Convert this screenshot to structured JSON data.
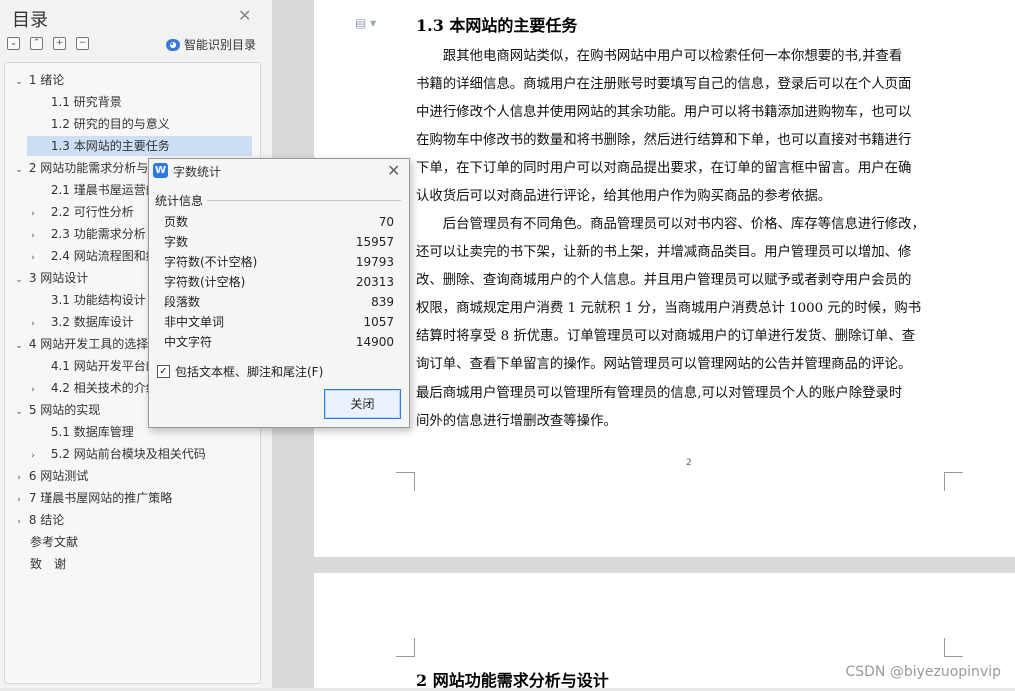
{
  "sidebar": {
    "title": "目录",
    "smart_toc_label": "智能识别目录",
    "toc": [
      {
        "label": "1 绪论",
        "level": 1,
        "arrow": "⌄"
      },
      {
        "label": "1.1 研究背景",
        "level": 2,
        "arrow": ""
      },
      {
        "label": "1.2 研究的目的与意义",
        "level": 2,
        "arrow": ""
      },
      {
        "label": "1.3 本网站的主要任务",
        "level": 2,
        "arrow": "",
        "selected": true
      },
      {
        "label": "2 网站功能需求分析与",
        "level": 1,
        "arrow": "⌄"
      },
      {
        "label": "2.1 瑾晨书屋运营的",
        "level": 2,
        "arrow": ""
      },
      {
        "label": "2.2 可行性分析",
        "level": 2,
        "arrow": "›"
      },
      {
        "label": "2.3 功能需求分析",
        "level": 2,
        "arrow": "›"
      },
      {
        "label": "2.4 网站流程图和结",
        "level": 2,
        "arrow": "›"
      },
      {
        "label": "3 网站设计",
        "level": 1,
        "arrow": "⌄"
      },
      {
        "label": "3.1 功能结构设计",
        "level": 2,
        "arrow": ""
      },
      {
        "label": "3.2 数据库设计",
        "level": 2,
        "arrow": "›"
      },
      {
        "label": "4 网站开发工具的选择",
        "level": 1,
        "arrow": "⌄"
      },
      {
        "label": "4.1 网站开发平台的",
        "level": 2,
        "arrow": ""
      },
      {
        "label": "4.2 相关技术的介绍",
        "level": 2,
        "arrow": "›"
      },
      {
        "label": "5 网站的实现",
        "level": 1,
        "arrow": "⌄"
      },
      {
        "label": "5.1 数据库管理",
        "level": 2,
        "arrow": ""
      },
      {
        "label": "5.2 网站前台模块及相关代码",
        "level": 2,
        "arrow": "›"
      },
      {
        "label": "6 网站测试",
        "level": 1,
        "arrow": "›"
      },
      {
        "label": "7 瑾晨书屋网站的推广策略",
        "level": 1,
        "arrow": "›"
      },
      {
        "label": "8 结论",
        "level": 1,
        "arrow": "›"
      },
      {
        "label": "参考文献",
        "level": 0,
        "arrow": ""
      },
      {
        "label": "致　谢",
        "level": 0,
        "arrow": ""
      }
    ]
  },
  "document": {
    "heading": "1.3 本网站的主要任务",
    "para1_lines": [
      "　　跟其他电商网站类似，在购书网站中用户可以检索任何一本你想要的书,并查看",
      "书籍的详细信息。商城用户在注册账号时要填写自己的信息，登录后可以在个人页面",
      "中进行修改个人信息并使用网站的其余功能。用户可以将书籍添加进购物车，也可以",
      "在购物车中修改书的数量和将书删除，然后进行结算和下单，也可以直接对书籍进行",
      "下单，在下订单的同时用户可以对商品提出要求，在订单的留言框中留言。用户在确",
      "认收货后可以对商品进行评论，给其他用户作为购买商品的参考依据。"
    ],
    "para2_lines": [
      "　　后台管理员有不同角色。商品管理员可以对书内容、价格、库存等信息进行修改，",
      "还可以让卖完的书下架，让新的书上架，并增减商品类目。用户管理员可以增加、修",
      "改、删除、查询商城用户的个人信息。并且用户管理员可以赋予或者剥夺用户会员的",
      "权限，商城规定用户消费 1 元就积 1 分，当商城用户消费总计 1000 元的时候，购书",
      "结算时将享受 8 折优惠。订单管理员可以对商城用户的订单进行发货、删除订单、查",
      "询订单、查看下单留言的操作。网站管理员可以管理网站的公告并管理商品的评论。",
      "最后商城用户管理员可以管理所有管理员的信息,可以对管理员个人的账户除登录时",
      "间外的信息进行增删改查等操作。"
    ],
    "page_number": "2",
    "heading2": "2 网站功能需求分析与设计",
    "watermark": "CSDN @biyezuopinvip"
  },
  "dialog": {
    "title": "字数统计",
    "section": "统计信息",
    "stats": [
      {
        "label": "页数",
        "value": "70"
      },
      {
        "label": "字数",
        "value": "15957"
      },
      {
        "label": "字符数(不计空格)",
        "value": "19793"
      },
      {
        "label": "字符数(计空格)",
        "value": "20313"
      },
      {
        "label": "段落数",
        "value": "839"
      },
      {
        "label": "非中文单词",
        "value": "1057"
      },
      {
        "label": "中文字符",
        "value": "14900"
      }
    ],
    "checkbox_label": "包括文本框、脚注和尾注(F)",
    "checkbox_checked": true,
    "close_label": "关闭"
  }
}
